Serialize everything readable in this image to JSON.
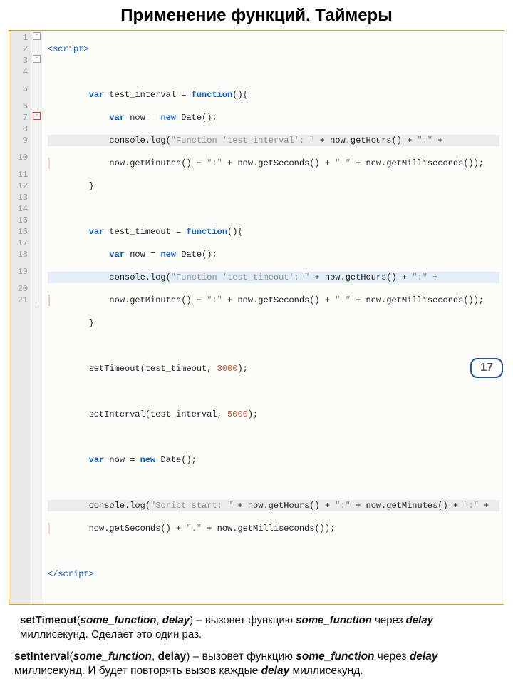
{
  "title": "Применение функций. Таймеры",
  "lines": [
    "1",
    "2",
    "3",
    "4",
    "5",
    "6",
    "7",
    "8",
    "9",
    "10",
    "11",
    "12",
    "13",
    "14",
    "15",
    "16",
    "17",
    "18",
    "19",
    "20",
    "21"
  ],
  "code": {
    "l1_tag_open": "<script>",
    "l3_a": "var",
    "l3_b": " test_interval = ",
    "l3_c": "function",
    "l3_d": "(){",
    "l4_a": "var",
    "l4_b": " now = ",
    "l4_c": "new",
    "l4_d": " Date();",
    "l5_a": "console.log(",
    "l5_b": "\"Function 'test_interval': \"",
    "l5_c": " + now.getHours() + ",
    "l5_d": "\":\"",
    "l5_e": " +",
    "l5b_a": "now.getMinutes() + ",
    "l5b_b": "\":\"",
    "l5b_c": " + now.getSeconds() + ",
    "l5b_d": "\".\"",
    "l5b_e": " + now.getMilliseconds());",
    "l6": "}",
    "l8_a": "var",
    "l8_b": " test_timeout = ",
    "l8_c": "function",
    "l8_d": "(){",
    "l9_a": "var",
    "l9_b": " now = ",
    "l9_c": "new",
    "l9_d": " Date();",
    "l10_a": "console.log(",
    "l10_b": "\"Function 'test_timeout': \"",
    "l10_c": " + now.getHours() + ",
    "l10_d": "\":\"",
    "l10_e": " +",
    "l10b_a": "now.getMinutes() + ",
    "l10b_b": "\":\"",
    "l10b_c": " + now.getSeconds() + ",
    "l10b_d": "\".\"",
    "l10b_e": " + now.getMilliseconds());",
    "l11": "}",
    "l13_a": "setTimeout(test_timeout, ",
    "l13_b": "3000",
    "l13_c": ");",
    "l15_a": "setInterval(test_interval, ",
    "l15_b": "5000",
    "l15_c": ");",
    "l17_a": "var",
    "l17_b": " now = ",
    "l17_c": "new",
    "l17_d": " Date();",
    "l19_a": "console.log(",
    "l19_b": "\"Script start: \"",
    "l19_c": " + now.getHours() + ",
    "l19_d": "\":\"",
    "l19_e": " + now.getMinutes() + ",
    "l19_f": "\":\"",
    "l19_g": " +",
    "l19b_a": "now.getSeconds() + ",
    "l19b_b": "\".\"",
    "l19b_c": " + now.getMilliseconds());",
    "l21_tag_close": "</script>"
  },
  "explain1": {
    "fn": "setTimeout",
    "p1": "some_function",
    "p2": "delay",
    "mid": "  –  вызовет функцию ",
    "mid2": " через ",
    "tail": " миллисекунд. Сделает это один раз."
  },
  "explain2": {
    "fn": "setInterval",
    "p1": "some_function",
    "p2": "delay",
    "mid": "  –  вызовет функцию ",
    "mid2": " через ",
    "tail1": " миллисекунд. И будет повторять вызов каждые ",
    "tail2": " миллисекунд."
  },
  "page": "17"
}
